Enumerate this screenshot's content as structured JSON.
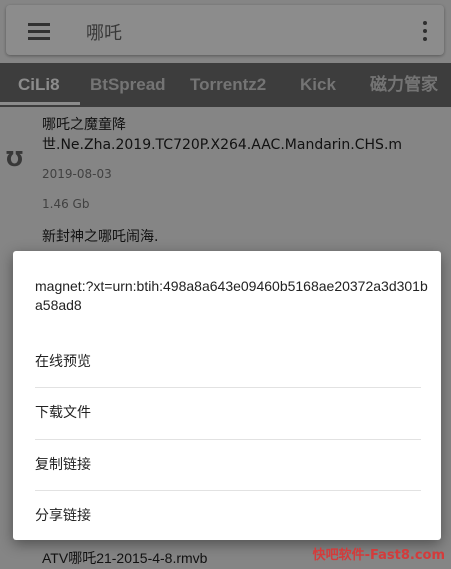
{
  "search": {
    "query": "哪吒"
  },
  "tabs": [
    "CiLi8",
    "BtSpread",
    "Torrentz2",
    "Kick",
    "磁力管家"
  ],
  "results": [
    {
      "title": "哪吒之魔童降世.Ne.Zha.2019.TC720P.X264.AAC.Mandarin.CHS.m",
      "date": "2019-08-03",
      "size": "1.46 Gb"
    },
    {
      "title": "新封神之哪吒闹海."
    }
  ],
  "dialog": {
    "magnet": "magnet:?xt=urn:btih:498a8a643e09460b5168ae20372a3d301ba58ad8",
    "options": [
      "在线预览",
      "下载文件",
      "复制链接",
      "分享链接"
    ]
  },
  "bottom_item": "ATV哪吒21-2015-4-8.rmvb",
  "watermark": "快吧软件-Fast8.com",
  "colors": {
    "tab_bar": "#6f6f6f",
    "overlay": "rgba(0,0,0,0.45)",
    "watermark": "#d43b3b"
  }
}
